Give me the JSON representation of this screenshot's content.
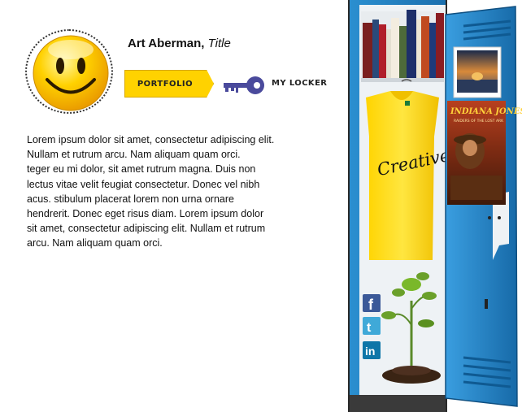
{
  "profile": {
    "name": "Art Aberman,",
    "title": "Title",
    "bio": "Lorem ipsum dolor sit amet, consectetur adipiscing elit.\nNullam et rutrum arcu. Nam aliquam quam orci.\nteger eu mi dolor, sit amet rutrum magna. Duis non\nlectus vitae velit feugiat consectetur. Donec vel nibh\nacus. stibulum placerat lorem non urna ornare\n hendrerit. Donec eget risus diam. Lorem ipsum dolor\nsit amet, consectetur adipiscing elit. Nullam et rutrum\narcu. Nam aliquam quam orci."
  },
  "nav": {
    "portfolio_label": "PORTFOLIO",
    "locker_label": "MY LOCKER"
  },
  "locker": {
    "shirt_text": "Creative",
    "poster_title": "INDIANA JONES",
    "poster_subtitle": "RAIDERS OF THE LOST ARK",
    "social": [
      "facebook-icon",
      "twitter-icon",
      "linkedin-icon"
    ]
  },
  "colors": {
    "locker_blue": "#1f7fc0",
    "accent_yellow": "#ffd200",
    "key_purple": "#4a4a9c"
  }
}
